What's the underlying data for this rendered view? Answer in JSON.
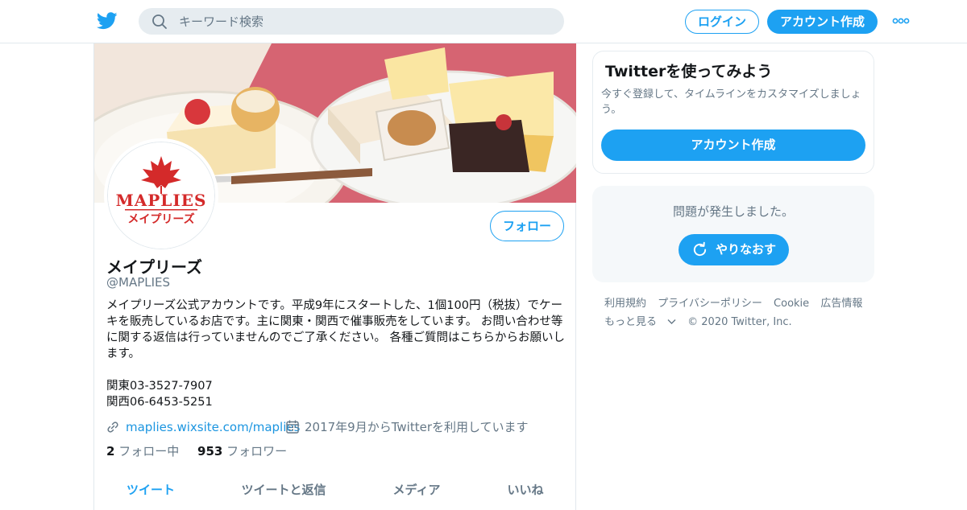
{
  "header": {
    "search_placeholder": "キーワード検索",
    "login_label": "ログイン",
    "signup_label": "アカウント作成"
  },
  "colors": {
    "accent": "#1da1f2",
    "text": "#14171a",
    "muted": "#657786"
  },
  "profile": {
    "avatar_brand": "MAPLIES",
    "avatar_brand_jp": "メイプリーズ",
    "follow_label": "フォロー",
    "name": "メイプリーズ",
    "handle": "@MAPLIES",
    "bio": "メイプリーズ公式アカウントです。平成9年にスタートした、1個100円（税抜）でケーキを販売しているお店です。主に関東・関西で催事販売をしています。 お問い合わせ等に関する返信は行っていませんのでご了承ください。 各種ご質問はこちらからお願いします。\n\n関東03-3527-7907\n関西06-6453-5251",
    "url": "maplies.wixsite.com/maplies",
    "joined": "2017年9月からTwitterを利用しています",
    "following_count": "2",
    "following_label": "フォロー中",
    "followers_count": "953",
    "followers_label": "フォロワー",
    "tabs": [
      {
        "label": "ツイート"
      },
      {
        "label": "ツイートと返信"
      },
      {
        "label": "メディア"
      },
      {
        "label": "いいね"
      }
    ]
  },
  "signup_card": {
    "title": "Twitterを使ってみよう",
    "subtitle": "今すぐ登録して、タイムラインをカスタマイズしましょう。",
    "button": "アカウント作成"
  },
  "error_card": {
    "message": "問題が発生しました。",
    "retry": "やりなおす"
  },
  "footer": {
    "links": [
      "利用規約",
      "プライバシーポリシー",
      "Cookie",
      "広告情報"
    ],
    "more": "もっと見る",
    "copyright": "© 2020 Twitter, Inc."
  }
}
